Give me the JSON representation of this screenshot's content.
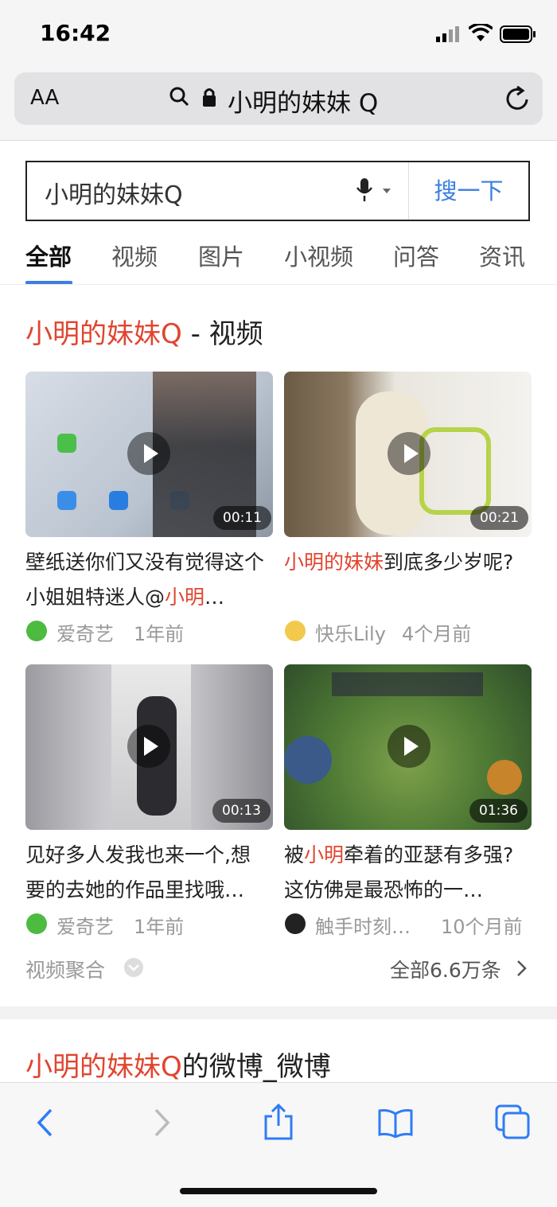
{
  "status": {
    "time": "16:42"
  },
  "browser": {
    "aa": "AA",
    "url_text": "小明的妹妹 Q"
  },
  "search": {
    "query": "小明的妹妹Q",
    "button": "搜一下"
  },
  "tabs": [
    {
      "label": "全部"
    },
    {
      "label": "视频"
    },
    {
      "label": "图片"
    },
    {
      "label": "小视频"
    },
    {
      "label": "问答"
    },
    {
      "label": "资讯"
    }
  ],
  "video_section": {
    "title_highlight": "小明的妹妹Q",
    "title_rest": " - 视频",
    "videos": [
      {
        "duration": "00:11",
        "title_before": "壁纸送你们又没有觉得这个小姐姐特迷人@",
        "title_highlight": "小明",
        "title_after": "…",
        "source": "爱奇艺",
        "time": "1年前"
      },
      {
        "duration": "00:21",
        "title_before": "",
        "title_highlight": "小明的妹妹",
        "title_after": "到底多少岁呢?",
        "source": "快乐Lily",
        "time": "4个月前"
      },
      {
        "duration": "00:13",
        "title_before": "见好多人发我也来一个,想要的去她的作品里找哦…",
        "title_highlight": "",
        "title_after": "",
        "source": "爱奇艺",
        "time": "1年前"
      },
      {
        "duration": "01:36",
        "title_before": "被",
        "title_highlight": "小明",
        "title_after": "牵着的亚瑟有多强?这仿佛是最恐怖的一…",
        "source": "触手时刻…",
        "time": "10个月前"
      }
    ],
    "aggregate_label": "视频聚合",
    "all_label": "全部6.6万条"
  },
  "weibo_section": {
    "title_highlight": "小明的妹妹Q",
    "title_rest": "的微博_微博"
  },
  "colors": {
    "accent": "#3b7fe0",
    "highlight": "#e0452f",
    "iqiyi": "#4cbb3f"
  }
}
